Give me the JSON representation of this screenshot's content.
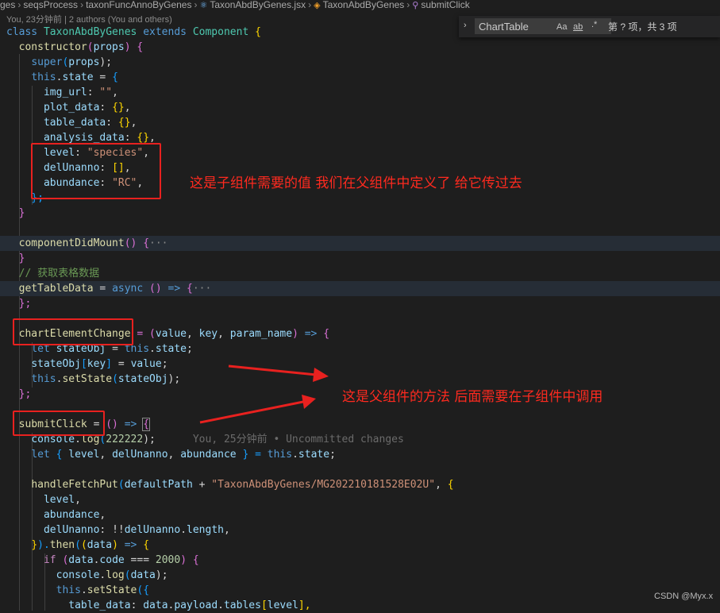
{
  "breadcrumb": {
    "items": [
      "ges",
      "seqsProcess",
      "taxonFuncAnnoByGenes",
      "TaxonAbdByGenes.jsx",
      "TaxonAbdByGenes",
      "submitClick"
    ]
  },
  "blame_header": "You, 23分钟前 | 2 authors (You and others)",
  "find_widget": {
    "query": "ChartTable",
    "match_case": "Aa",
    "whole_word": "ab",
    "regex": ".*",
    "result": "第 ? 项，共 3 项"
  },
  "annotations": {
    "note1": "这是子组件需要的值 我们在父组件中定义了 给它传过去",
    "note2": "这是父组件的方法  后面需要在子组件中调用"
  },
  "code": {
    "l1": {
      "a": "class",
      "b": "TaxonAbdByGenes",
      "c": "extends",
      "d": "Component",
      "e": "{"
    },
    "l2": {
      "a": "constructor",
      "b": "(",
      "c": "props",
      "d": ")",
      "e": " {"
    },
    "l3": {
      "a": "super",
      "b": "(",
      "c": "props",
      "d": ");"
    },
    "l4": {
      "a": "this",
      "b": ".",
      "c": "state",
      "d": " = ",
      "e": "{"
    },
    "l5": {
      "a": "img_url",
      "b": ": ",
      "c": "\"\"",
      "d": ","
    },
    "l6": {
      "a": "plot_data",
      "b": ": ",
      "c": "{}",
      "d": ","
    },
    "l7": {
      "a": "table_data",
      "b": ": ",
      "c": "{}",
      "d": ","
    },
    "l8": {
      "a": "analysis_data",
      "b": ": ",
      "c": "{}",
      "d": ","
    },
    "l9": {
      "a": "level",
      "b": ": ",
      "c": "\"species\"",
      "d": ","
    },
    "l10": {
      "a": "delUnanno",
      "b": ": ",
      "c": "[]",
      "d": ","
    },
    "l11": {
      "a": "abundance",
      "b": ": ",
      "c": "\"RC\"",
      "d": ","
    },
    "l12": {
      "a": "};"
    },
    "l13": {
      "a": "}"
    },
    "l15": {
      "a": "componentDidMount",
      "b": "()",
      "c": " {",
      "d": "···"
    },
    "l16": {
      "a": "}"
    },
    "l17": {
      "a": "// 获取表格数据"
    },
    "l18": {
      "a": "getTableData",
      "b": " = ",
      "c": "async",
      "d": " () ",
      "e": "=>",
      "f": " {",
      "g": "···"
    },
    "l19": {
      "a": "};"
    },
    "l21": {
      "a": "chartElementChange",
      "b": " = (",
      "c": "value",
      "d": ", ",
      "e": "key",
      "f": ", ",
      "g": "param_name",
      "h": ") ",
      "i": "=>",
      "j": " {"
    },
    "l22": {
      "a": "let",
      "b": " ",
      "c": "stateObj",
      "d": " = ",
      "e": "this",
      "f": ".",
      "g": "state",
      "h": ";"
    },
    "l23": {
      "a": "stateObj",
      "b": "[",
      "c": "key",
      "d": "]",
      "e": " = ",
      "f": "value",
      "g": ";"
    },
    "l24": {
      "a": "this",
      "b": ".",
      "c": "setState",
      "d": "(",
      "e": "stateObj",
      "f": ");"
    },
    "l25": {
      "a": "};"
    },
    "l27": {
      "a": "submitClick",
      "b": " = ",
      "c": "()",
      "d": " => ",
      "e": "{"
    },
    "l28": {
      "a": "console",
      "b": ".",
      "c": "log",
      "d": "(",
      "e": "222222",
      "f": ");",
      "g": "You, 25分钟前 • Uncommitted changes"
    },
    "l29": {
      "a": "let",
      "b": " { ",
      "c": "level",
      "d": ", ",
      "e": "delUnanno",
      "f": ", ",
      "g": "abundance",
      "h": " } = ",
      "i": "this",
      "j": ".",
      "k": "state",
      "l": ";"
    },
    "l31": {
      "a": "handleFetchPut",
      "b": "(",
      "c": "defaultPath",
      "d": " + ",
      "e": "\"TaxonAbdByGenes/MG202210181528E02U\"",
      "f": ", ",
      "g": "{"
    },
    "l32": {
      "a": "level",
      "b": ","
    },
    "l33": {
      "a": "abundance",
      "b": ","
    },
    "l34": {
      "a": "delUnanno",
      "b": ": !!",
      "c": "delUnanno",
      "d": ".",
      "e": "length",
      "f": ","
    },
    "l35": {
      "a": "}",
      "b": ").",
      "c": "then",
      "d": "(",
      "e": "(",
      "f": "data",
      "g": ")",
      "h": " => ",
      "i": "{"
    },
    "l36": {
      "a": "if",
      "b": " (",
      "c": "data",
      "d": ".",
      "e": "code",
      "f": " === ",
      "g": "2000",
      "h": ") ",
      "i": "{"
    },
    "l37": {
      "a": "console",
      "b": ".",
      "c": "log",
      "d": "(",
      "e": "data",
      "f": ");"
    },
    "l38": {
      "a": "this",
      "b": ".",
      "c": "setState",
      "d": "({"
    },
    "l39": {
      "a": "table_data",
      "b": ": ",
      "c": "data",
      "d": ".",
      "e": "payload",
      "f": ".",
      "g": "tables",
      "h": "[",
      "i": "level",
      "j": "],"
    }
  },
  "watermark": "CSDN @Myx.x"
}
